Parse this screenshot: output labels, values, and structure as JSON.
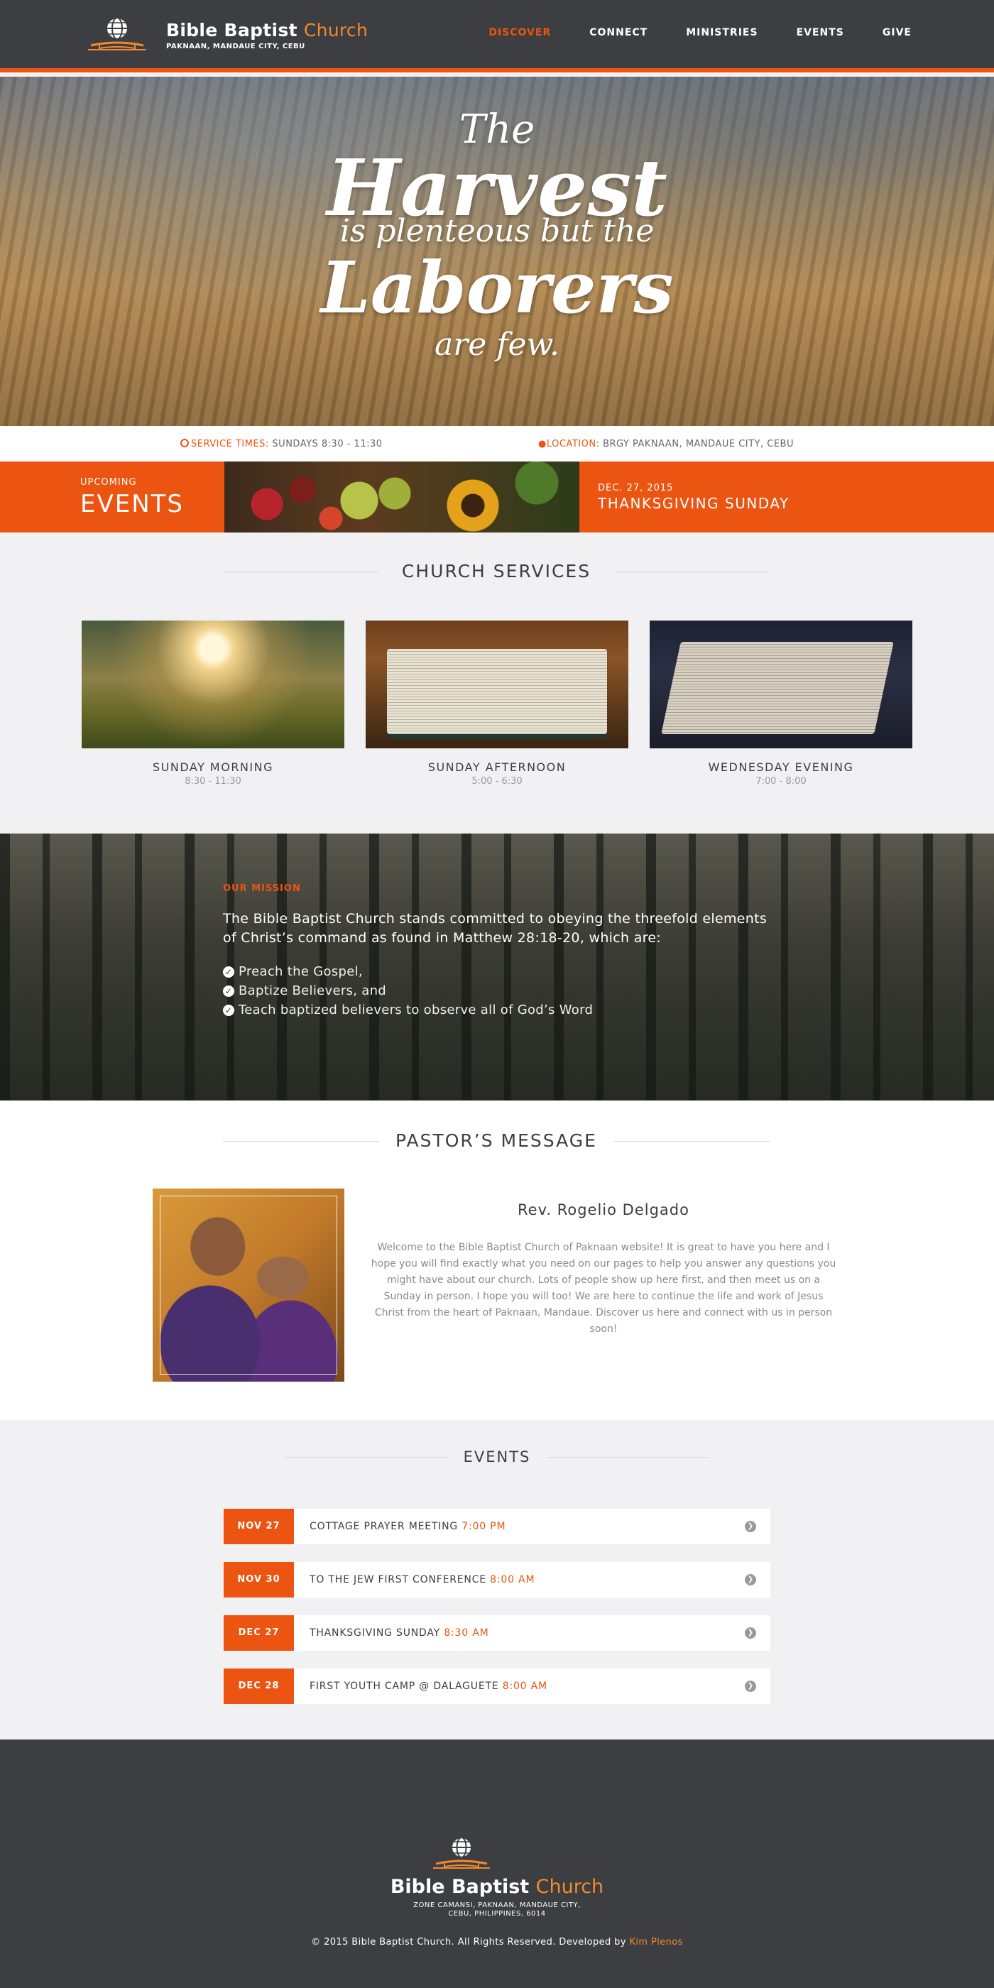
{
  "header": {
    "church_name": "Bible Baptist",
    "church_name_accent": "Church",
    "tagline": "PAKNAAN, MANDAUE CITY, CEBU",
    "nav": [
      "DISCOVER",
      "CONNECT",
      "MINISTRIES",
      "EVENTS",
      "GIVE"
    ],
    "active_nav": "DISCOVER"
  },
  "hero": {
    "line1": "The",
    "line2": "Harvest",
    "line3": "is plenteous but the",
    "line4": "Laborers",
    "line5": "are few."
  },
  "info": {
    "service_label": "SERVICE TIMES:",
    "service_value": "SUNDAYS 8:30 - 11:30",
    "location_label": "LOCATION:",
    "location_value": "BRGY PAKNAAN, MANDAUE CITY, CEBU"
  },
  "upcoming": {
    "small": "UPCOMING",
    "big": "EVENTS",
    "date": "DEC. 27, 2015",
    "title": "THANKSGIVING SUNDAY"
  },
  "services": {
    "heading": "CHURCH SERVICES",
    "items": [
      {
        "title": "SUNDAY MORNING",
        "time": "8:30 - 11:30"
      },
      {
        "title": "SUNDAY AFTERNOON",
        "time": "5:00 - 6:30"
      },
      {
        "title": "WEDNESDAY EVENING",
        "time": "7:00 - 8:00"
      }
    ]
  },
  "mission": {
    "label": "OUR MISSION",
    "text": "The Bible Baptist Church stands committed to obeying the threefold elements of Christ’s command as found in Matthew 28:18-20, which are:",
    "points": [
      "Preach the Gospel,",
      "Baptize Believers, and",
      "Teach baptized believers to observe all of God’s Word"
    ]
  },
  "pastor": {
    "heading": "PASTOR’S MESSAGE",
    "name": "Rev. Rogelio Delgado",
    "message": "Welcome to the Bible Baptist Church of Paknaan website! It is great to have you here and I hope you will find exactly what you need on our pages to help you answer any questions you might have about our church. Lots of people show up here first, and then meet us on a Sunday in person. I hope you will too! We are here to continue the life and work of Jesus Christ from the heart of Paknaan, Mandaue. Discover us here and connect with us in person soon!"
  },
  "events": {
    "heading": "EVENTS",
    "items": [
      {
        "date": "NOV 27",
        "title": "COTTAGE PRAYER MEETING",
        "time": "7:00 PM"
      },
      {
        "date": "NOV 30",
        "title": "TO THE JEW FIRST CONFERENCE",
        "time": "8:00 AM"
      },
      {
        "date": "DEC 27",
        "title": "THANKSGIVING SUNDAY",
        "time": "8:30 AM"
      },
      {
        "date": "DEC 28",
        "title": "FIRST YOUTH CAMP @ DALAGUETE",
        "time": "8:00 AM"
      }
    ]
  },
  "footer": {
    "church_name": "Bible Baptist",
    "church_name_accent": "Church",
    "address_line1": "ZONE CAMANSI, PAKNAAN, MANDAUE CITY,",
    "address_line2": "CEBU, PHILIPPINES, 6014",
    "copyright": "© 2015 Bible Baptist Church. All Rights Reserved. Developed by",
    "developer": "Kim Plenos"
  },
  "colors": {
    "accent": "#ec5411",
    "accent_light": "#f2892d",
    "dark": "#3d3e41",
    "light_bg": "#f1f1f3"
  }
}
